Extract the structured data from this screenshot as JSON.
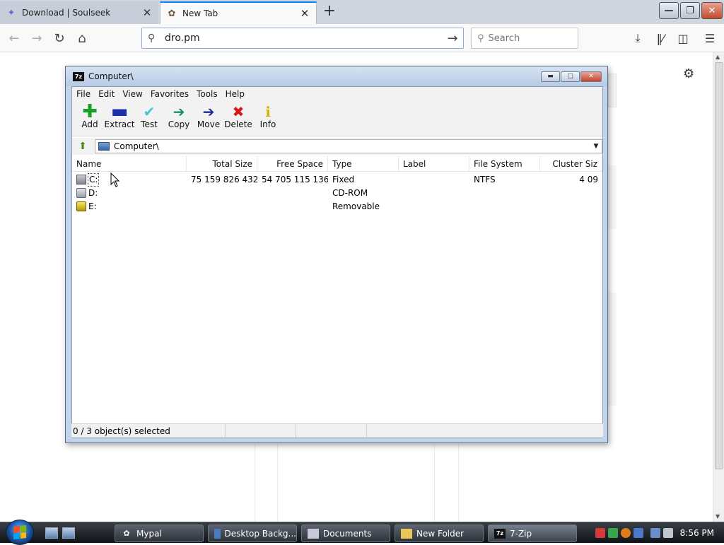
{
  "browser": {
    "tabs": [
      {
        "label": "Download | Soulseek",
        "icon": "soulseek-bird-icon"
      },
      {
        "label": "New Tab",
        "icon": "newtab-icon"
      }
    ],
    "url_value": "dro.pm",
    "search_placeholder": "Search"
  },
  "zip": {
    "title": "Computer\\",
    "menu": [
      "File",
      "Edit",
      "View",
      "Favorites",
      "Tools",
      "Help"
    ],
    "toolbar": [
      {
        "label": "Add",
        "icon": "plus-icon",
        "color": "#19a02a"
      },
      {
        "label": "Extract",
        "icon": "minus-icon",
        "color": "#1c2fa6"
      },
      {
        "label": "Test",
        "icon": "checkmark-icon",
        "color": "#3cc6d8"
      },
      {
        "label": "Copy",
        "icon": "arrow-right-icon",
        "color": "#1e8a72"
      },
      {
        "label": "Move",
        "icon": "arrow-right-icon",
        "color": "#1b2a8c"
      },
      {
        "label": "Delete",
        "icon": "x-icon",
        "color": "#d21818"
      },
      {
        "label": "Info",
        "icon": "info-icon",
        "color": "#d9b000"
      }
    ],
    "address": "Computer\\",
    "columns": [
      "Name",
      "Total Size",
      "Free Space",
      "Type",
      "Label",
      "File System",
      "Cluster Siz"
    ],
    "rows": [
      {
        "name": "C:",
        "total": "75 159 826 432",
        "free": "54 705 115 136",
        "type": "Fixed",
        "label": "",
        "fs": "NTFS",
        "cluster": "4 09"
      },
      {
        "name": "D:",
        "total": "",
        "free": "",
        "type": "CD-ROM",
        "label": "",
        "fs": "",
        "cluster": ""
      },
      {
        "name": "E:",
        "total": "",
        "free": "",
        "type": "Removable",
        "label": "",
        "fs": "",
        "cluster": ""
      }
    ],
    "status": "0 / 3 object(s) selected"
  },
  "taskbar": {
    "items": [
      {
        "label": "Mypal"
      },
      {
        "label": "Desktop Backg..."
      },
      {
        "label": "Documents"
      },
      {
        "label": "New Folder"
      },
      {
        "label": "7-Zip"
      }
    ],
    "clock": "8:56 PM"
  }
}
